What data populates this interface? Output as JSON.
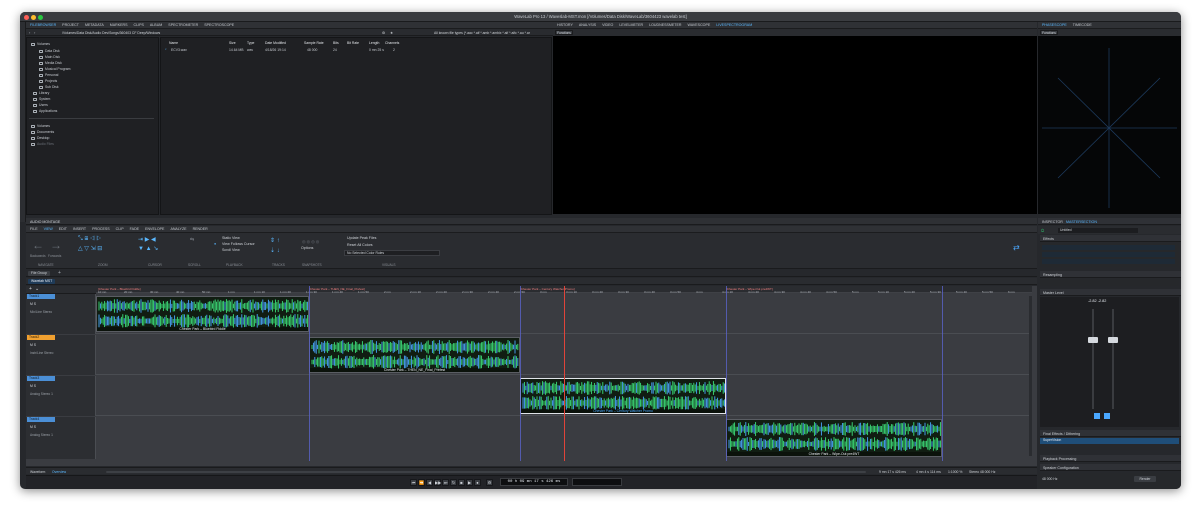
{
  "window": {
    "title": "WaveLab Pro 13 / Waveslab-MST.mon [/Volumes/Data Disk/WaveLab/3604423 wavelab test]",
    "traffic_colors": [
      "#ff5f57",
      "#febc2e",
      "#28c840"
    ]
  },
  "browser_tabs": [
    "FILEBROWSER",
    "PROJECT",
    "METADATA",
    "MARKERS",
    "CLIPS",
    "ALBUM",
    "SPECTROMETER",
    "SPECTROSCOPE"
  ],
  "browser_path": "/Volumes/Data Disk/Audio Dev/Songs/360403 CF Deep/Windows",
  "filter_text": "All known file types (*.aac *.aif *.amb *.ambix *.aif *.aifc *.au *.ar",
  "tree": {
    "root": "Volumes",
    "items": [
      "Data Disk",
      "Main Disk",
      "Media Disk",
      "Musical Program",
      "Personal",
      "Projects",
      "Sub Disk",
      "Library",
      "System",
      "Users",
      "Applications"
    ],
    "favorites": [
      "Volumes",
      "Documents",
      "Desktop",
      "Audio Files"
    ]
  },
  "file_table": {
    "headers": [
      "Name",
      "Size",
      "Type",
      "Date Modified",
      "Sample Rate",
      "Bits",
      "Bit Rate",
      "Length",
      "Channels"
    ],
    "rows": [
      {
        "name": "ECV3.wav",
        "size": "14.64 MB",
        "type": "wav",
        "date": "4/18/26 19:14",
        "rate": "48 000",
        "bits": "24",
        "bitrate": "",
        "length": "0 mn 25 s",
        "channels": "2"
      }
    ]
  },
  "center_tabs": [
    "HISTORY",
    "ANALYSIS",
    "VIDEO",
    "LEVELMETER",
    "LOUDNESSMETER",
    "WAVESCOPE",
    "LIVESPECTROGRAM"
  ],
  "center_functions": "Functions",
  "scope_tabs": [
    "PHASESCOPE",
    "TIMECODE"
  ],
  "scope_functions": "Functions",
  "montage": {
    "title": "AUDIO MONTAGE",
    "ribbon_tabs": [
      "FILE",
      "VIEW",
      "EDIT",
      "INSERT",
      "PROCESS",
      "CLIP",
      "FADE",
      "ENVELOPE",
      "ANALYZE",
      "RENDER"
    ],
    "ribbon_groups": [
      "NAVIGATE",
      "ZOOM",
      "CURSOR",
      "SCROLL",
      "PLAYBACK",
      "TRACKS",
      "SNAPSHOTS",
      "VISUALS"
    ],
    "nav_labels": [
      "Backwards",
      "Forwards"
    ],
    "view_options": [
      "Static View",
      "View Follows Cursor",
      "Scroll View"
    ],
    "visual_options": [
      "Update Peak Files",
      "Reset All Colors",
      "No Selected Color Rules"
    ],
    "options_label": "Options",
    "file_group": "File Group",
    "montage_tab": "Wavelab MST",
    "markers": [
      "[Chester Park – Bluebird Fiddle]",
      "[Chester Park – THEN_NE_Final_Prefest]",
      "[Chester Park – Century Watcher Promo]",
      "[Chester Park – Wipe-Out pre4WT]"
    ],
    "ruler_ticks": [
      "10 mn",
      "20 mn",
      "30 mn",
      "40 mn",
      "50 mn",
      "1 mn",
      "1 mn 10",
      "1 mn 20",
      "1 mn 30",
      "1 mn 40",
      "1 mn 50",
      "2 mn",
      "2 mn 10",
      "2 mn 20",
      "2 mn 30",
      "2 mn 40",
      "2 mn 50",
      "3 mn",
      "3 mn 10",
      "3 mn 20",
      "3 mn 30",
      "3 mn 40",
      "3 mn 50",
      "4 mn",
      "4 mn 10",
      "4 mn 20",
      "4 mn 30",
      "4 mn 40",
      "4 mn 50",
      "5 mn",
      "5 mn 10",
      "5 mn 20",
      "5 mn 30",
      "5 mn 40",
      "5 mn 50",
      "6 mn"
    ],
    "tracks": [
      {
        "name": "Track1",
        "sub": "Mix/Line Stereo",
        "color": "#4b8fd6"
      },
      {
        "name": "Track2",
        "sub": "Instr/Line Stereo",
        "color": "#f0a030"
      },
      {
        "name": "Track3",
        "sub": "Analog Stereo 1",
        "color": "#4b8fd6"
      },
      {
        "name": "Track4",
        "sub": "Analog Stereo 1",
        "color": "#4b8fd6"
      }
    ],
    "clips": [
      {
        "label": "Chester Park – Bluebird Fiddle"
      },
      {
        "label": "Chester Park – THEN_NE_Final_Prefest"
      },
      {
        "label": "Chester Park – Century Watcher Promo"
      },
      {
        "label": "Chester Park – Wipe-Out pre4WT"
      }
    ],
    "bottom_tabs": [
      "Waveform",
      "Overview"
    ],
    "status": [
      "9 mn 17 s 426 ms",
      "4 mn 4 s 114 ms",
      "1:1000 %",
      "Stereo 48 000 Hz"
    ]
  },
  "transport": {
    "time": "00 h 09 mn 17 s 426 ms"
  },
  "inspector": {
    "tabs": [
      "INSPECTOR",
      "MASTERSECTION"
    ],
    "preset": "Untitled",
    "sections": [
      "Effects",
      "Resampling",
      "Master Level",
      "Final Effects / Dithering",
      "Playback Processing",
      "Speaker Configuration"
    ],
    "master_level": "-2.82  -2.82",
    "dither_item": "SuperVision",
    "sample_rate": "48 000 Hz",
    "render": "Render"
  },
  "colors": {
    "accent": "#5ab8ff",
    "wave_green": "#3de07a",
    "wave_blue": "#4aa8ff",
    "playhead": "#e0443a",
    "track_orange": "#f0a030"
  }
}
